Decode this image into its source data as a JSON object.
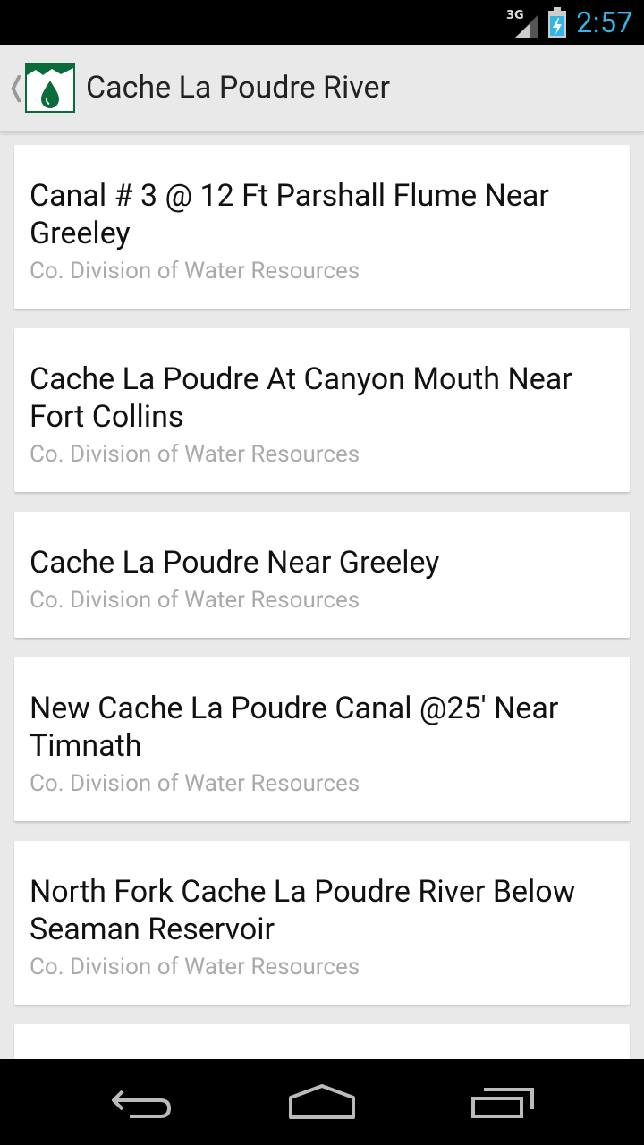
{
  "status_bar": {
    "network": "3G",
    "time": "2:57",
    "accent_color": "#33b5e5"
  },
  "action_bar": {
    "title": "Cache La Poudre River",
    "up_icon": "chevron-left-icon",
    "logo_icon": "water-drop-logo"
  },
  "stations": [
    {
      "name": "Canal # 3 @ 12 Ft Parshall Flume Near Greeley",
      "source": "Co. Division of Water Resources"
    },
    {
      "name": "Cache La Poudre At Canyon Mouth Near Fort Collins",
      "source": "Co. Division of Water Resources"
    },
    {
      "name": "Cache La Poudre Near Greeley",
      "source": "Co. Division of Water Resources"
    },
    {
      "name": "New Cache La Poudre Canal @25' Near Timnath",
      "source": "Co. Division of Water Resources"
    },
    {
      "name": "North Fork Cache La Poudre River Below Seaman Reservoir",
      "source": "Co. Division of Water Resources"
    }
  ],
  "nav_bar": {
    "back": "back-icon",
    "home": "home-icon",
    "recents": "recents-icon"
  }
}
